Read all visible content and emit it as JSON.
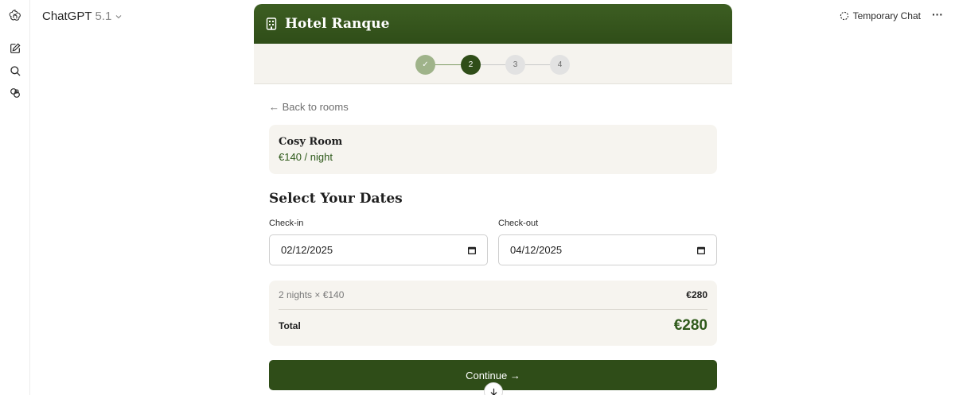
{
  "topbar": {
    "model_name": "ChatGPT",
    "model_version": "5.1",
    "temporary_chat_label": "Temporary Chat",
    "more_label": "···"
  },
  "rail": {
    "icons": [
      "openai-logo-icon",
      "new-chat-icon",
      "search-icon",
      "library-icon"
    ]
  },
  "app": {
    "title": "Hotel Ranque",
    "header_icon": "building-icon",
    "brand_color": "#2f4d18",
    "stepper": {
      "steps": [
        {
          "label": "✓",
          "state": "done"
        },
        {
          "label": "2",
          "state": "current"
        },
        {
          "label": "3",
          "state": "todo"
        },
        {
          "label": "4",
          "state": "todo"
        }
      ]
    },
    "back_link": "← Back to rooms",
    "room": {
      "name": "Cosy Room",
      "price": "€140 / night"
    },
    "section_title": "Select Your Dates",
    "check_in": {
      "label": "Check-in",
      "value": "02/12/2025"
    },
    "check_out": {
      "label": "Check-out",
      "value": "04/12/2025"
    },
    "summary": {
      "line_label": "2 nights × €140",
      "line_value": "€280",
      "total_label": "Total",
      "total_value": "€280"
    },
    "continue_label": "Continue →"
  }
}
